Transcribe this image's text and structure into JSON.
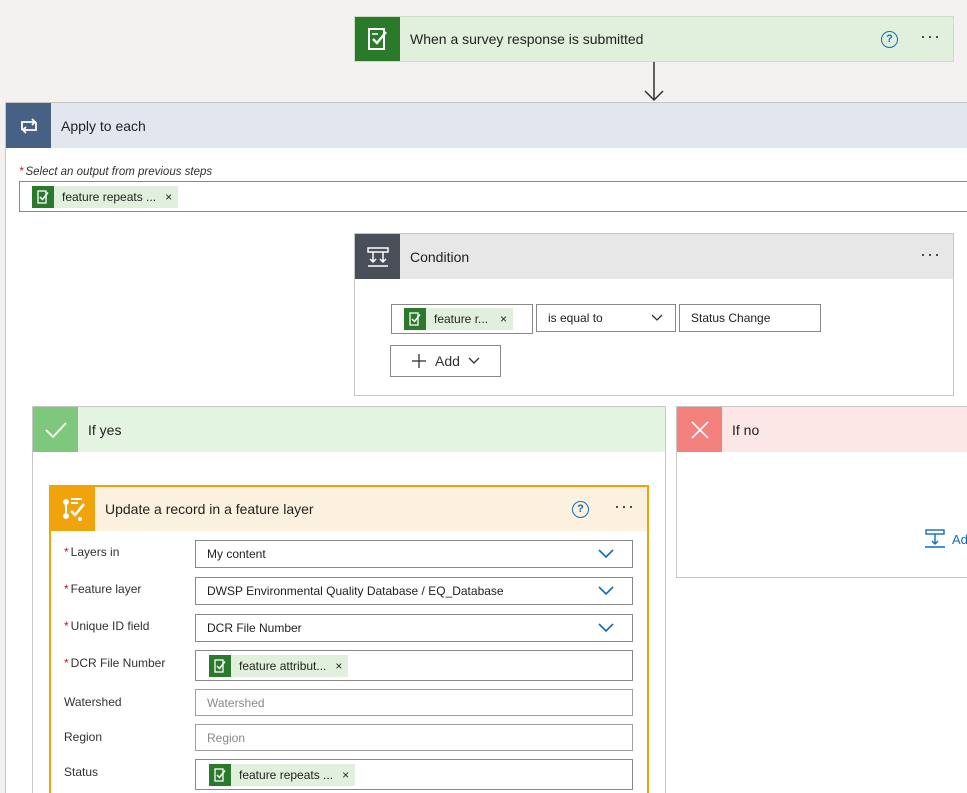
{
  "trigger": {
    "title": "When a survey response is submitted",
    "help": "?",
    "more": "···"
  },
  "apply_each": {
    "title": "Apply to each",
    "select_label": "Select an output from previous steps",
    "required_mark": "*",
    "token": "feature repeats ...",
    "token_remove": "×"
  },
  "condition": {
    "title": "Condition",
    "more": "···",
    "left_token": "feature r...",
    "token_remove": "×",
    "operator": "is equal to",
    "value": "Status Change",
    "add_label": "Add"
  },
  "if_yes": {
    "title": "If yes"
  },
  "if_no": {
    "title": "If no",
    "add_label": "Ad"
  },
  "update_action": {
    "title": "Update a record in a feature layer",
    "help": "?",
    "more": "···",
    "required_mark": "*",
    "fields": {
      "layers_in": {
        "label": "Layers in",
        "value": "My content"
      },
      "feature_layer": {
        "label": "Feature layer",
        "value": "DWSP Environmental Quality Database / EQ_Database"
      },
      "unique_id": {
        "label": "Unique ID field",
        "value": "DCR File Number"
      },
      "dcr_file": {
        "label": "DCR File Number",
        "token": "feature attribut...",
        "remove": "×"
      },
      "watershed": {
        "label": "Watershed",
        "placeholder": "Watershed"
      },
      "region": {
        "label": "Region",
        "placeholder": "Region"
      },
      "status": {
        "label": "Status",
        "token": "feature repeats ...",
        "remove": "×"
      }
    }
  },
  "colors": {
    "survey_green": "#2b7a2b",
    "trigger_header": "#e1efdd",
    "apply_header": "#e2e6ef",
    "apply_icon": "#476185",
    "condition_icon": "#484f58",
    "yes_green": "#7ec87e",
    "no_red": "#f3817d",
    "update_orange": "#f0a30a",
    "link_blue": "#0f6cbd"
  }
}
